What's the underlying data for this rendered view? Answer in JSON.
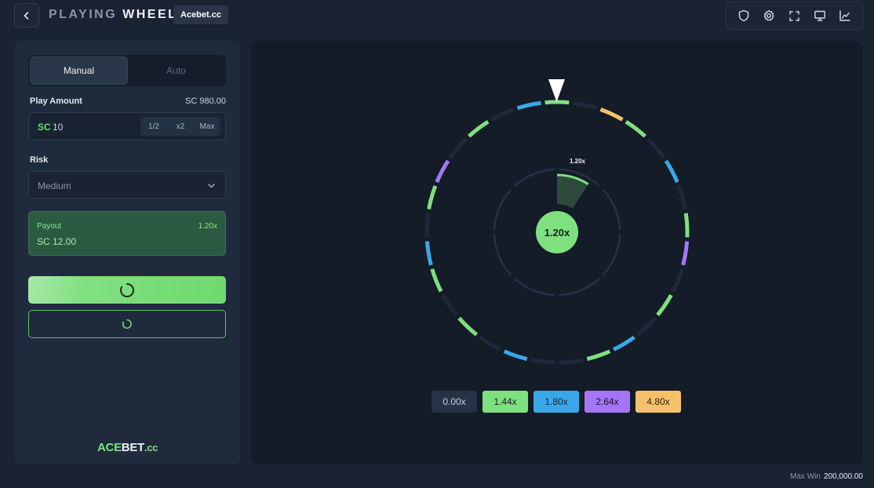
{
  "header": {
    "title_part1": "PLAYING",
    "title_part2": "WHEEL",
    "badge": "Acebet.cc",
    "back_icon": "chevron-left-icon",
    "tools": [
      "shield-icon",
      "gear-icon",
      "fullscreen-icon",
      "monitor-icon",
      "chart-icon"
    ]
  },
  "left_panel": {
    "tabs": [
      {
        "label": "Manual",
        "active": true
      },
      {
        "label": "Auto",
        "active": false
      }
    ],
    "play_amount": {
      "label": "Play Amount",
      "balance": "SC 980.00",
      "currency": "SC",
      "value": "10",
      "buttons": [
        "1/2",
        "x2",
        "Max"
      ]
    },
    "risk": {
      "label": "Risk",
      "selected": "Medium"
    },
    "payout": {
      "label": "Payout",
      "multiplier": "1.20x",
      "value": "SC 12.00"
    },
    "logo": {
      "part1": "ACE",
      "part2": "BET",
      "part3": ".cc"
    }
  },
  "wheel": {
    "center_value": "1.20x",
    "marker_label": "1.20x",
    "segment_colors": [
      "#7fe07f",
      "#1e2a3b",
      "#f5c26b",
      "#7fe07f",
      "#1e2a3b",
      "#3aa8e8",
      "#1e2a3b",
      "#7fe07f",
      "#a476f5",
      "#1e2a3b",
      "#7fe07f",
      "#1e2a3b",
      "#3aa8e8",
      "#7fe07f",
      "#1e2a3b",
      "#1e2a3b",
      "#3aa8e8",
      "#1e2a3b",
      "#7fe07f",
      "#1e2a3b",
      "#7fe07f",
      "#3aa8e8",
      "#1e2a3b",
      "#7fe07f",
      "#a476f5",
      "#1e2a3b",
      "#7fe07f",
      "#1e2a3b",
      "#3aa8e8"
    ]
  },
  "legend": [
    {
      "label": "0.00x",
      "bg": "#263246",
      "color": "#c9d1dc"
    },
    {
      "label": "1.44x",
      "bg": "#7fe07f",
      "color": "#122018"
    },
    {
      "label": "1.80x",
      "bg": "#3aa8e8",
      "color": "#0e1f2c"
    },
    {
      "label": "2.64x",
      "bg": "#a476f5",
      "color": "#1b1030"
    },
    {
      "label": "4.80x",
      "bg": "#f5c26b",
      "color": "#2c1f08"
    }
  ],
  "footer": {
    "max_win_label": "Max Win",
    "max_win_value": "200,000.00"
  }
}
